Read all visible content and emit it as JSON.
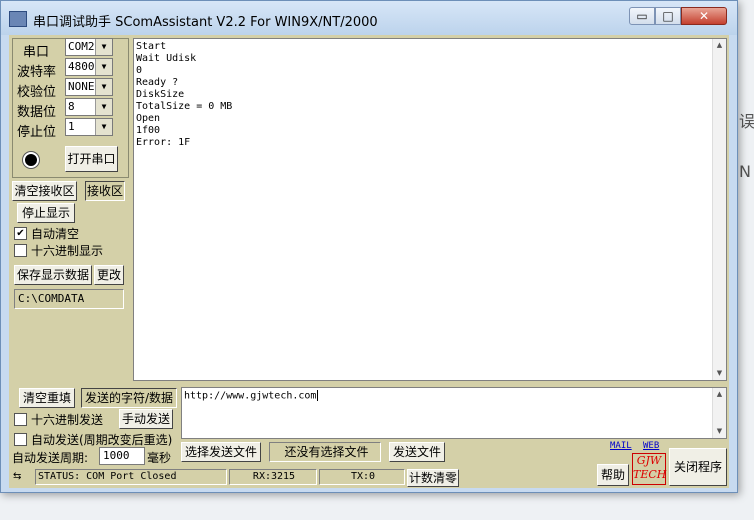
{
  "window": {
    "title": "串口调试助手 SComAssistant V2.2 For WIN9X/NT/2000",
    "min_glyph": "▭",
    "max_glyph": "□",
    "close_glyph": "✕"
  },
  "serial": {
    "port_label": "串口",
    "port_value": "COM2",
    "baud_label": "波特率",
    "baud_value": "4800",
    "parity_label": "校验位",
    "parity_value": "NONE",
    "databits_label": "数据位",
    "databits_value": "8",
    "stopbits_label": "停止位",
    "stopbits_value": "1",
    "open_button": "打开串口"
  },
  "receive": {
    "clear_button": "清空接收区",
    "area_label": "接收区",
    "stop_display_button": "停止显示",
    "auto_clear_label": "自动清空",
    "auto_clear_checked": true,
    "hex_display_label": "十六进制显示",
    "hex_display_checked": false,
    "save_button": "保存显示数据",
    "change_button": "更改",
    "save_path": "C:\\COMDATA",
    "text": "Start\nWait Udisk\n0\nReady ?\nDiskSize\nTotalSize = 0 MB\nOpen\n1f00\nError: 1F"
  },
  "send": {
    "clear_button": "清空重填",
    "area_label": "发送的字符/数据",
    "hex_send_label": "十六进制发送",
    "hex_send_checked": false,
    "manual_send_button": "手动发送",
    "auto_send_label": "自动发送(周期改变后重选)",
    "auto_send_checked": false,
    "period_label": "自动发送周期:",
    "period_value": "1000",
    "period_unit": "毫秒",
    "select_file_button": "选择发送文件",
    "file_status": "还没有选择文件",
    "send_file_button": "发送文件",
    "text": "http://www.gjwtech.com"
  },
  "status": {
    "status_text": "STATUS: COM Port Closed",
    "rx_text": "RX:3215",
    "tx_text": "TX:0",
    "reset_count_button": "计数清零"
  },
  "footer": {
    "mail_link": "MAIL",
    "web_link": "WEB",
    "help_button": "帮助",
    "logo_line1": "GJW",
    "logo_line2": "TECH",
    "close_program_button": "关闭程序"
  },
  "background": {
    "right_char_1": "误",
    "right_char_2": "N"
  }
}
